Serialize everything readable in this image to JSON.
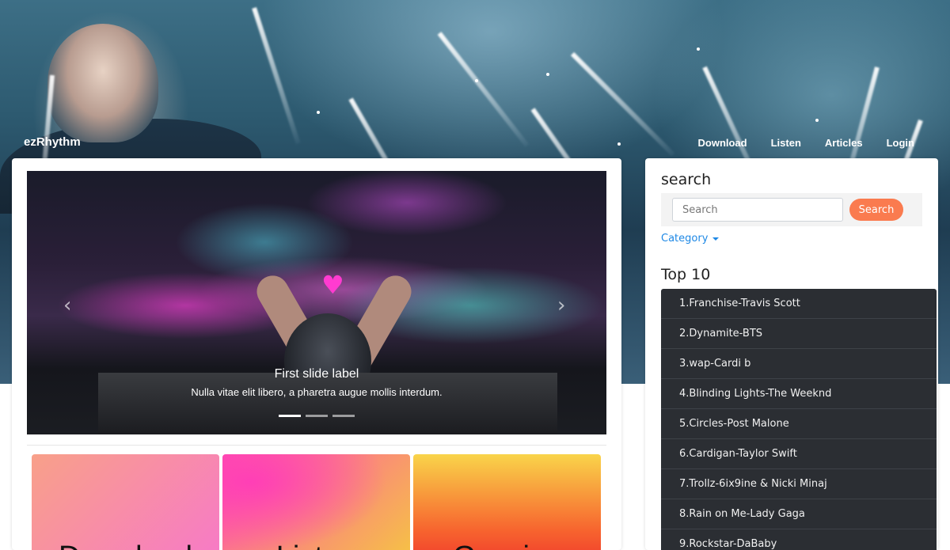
{
  "navbar": {
    "brand": "ezRhythm",
    "links": [
      "Download",
      "Listen",
      "Articles",
      "Login"
    ]
  },
  "carousel": {
    "slide_title": "First slide label",
    "slide_text": "Nulla vitae elit libero, a pharetra augue mollis interdum.",
    "prev_icon": "chevron-left-icon",
    "next_icon": "chevron-right-icon",
    "slide_count": 3,
    "active_slide": 1
  },
  "tiles": [
    "Download",
    "Listen",
    "Gossips"
  ],
  "sidebar": {
    "search_title": "search",
    "search_placeholder": "Search",
    "search_button": "Search",
    "category_label": "Category",
    "top_title": "Top 10",
    "top_items": [
      "1.Franchise-Travis Scott",
      "2.Dynamite-BTS",
      "3.wap-Cardi b",
      "4.Blinding Lights-The Weeknd",
      "5.Circles-Post Malone",
      "6.Cardigan-Taylor Swift",
      "7.Trollz-6ix9ine & Nicki Minaj",
      "8.Rain on Me-Lady Gaga",
      "9.Rockstar-DaBaby"
    ]
  },
  "colors": {
    "search_button": "#fa7b4f",
    "category_link": "#1e88e5",
    "top_list_bg": "#2b2e33"
  }
}
